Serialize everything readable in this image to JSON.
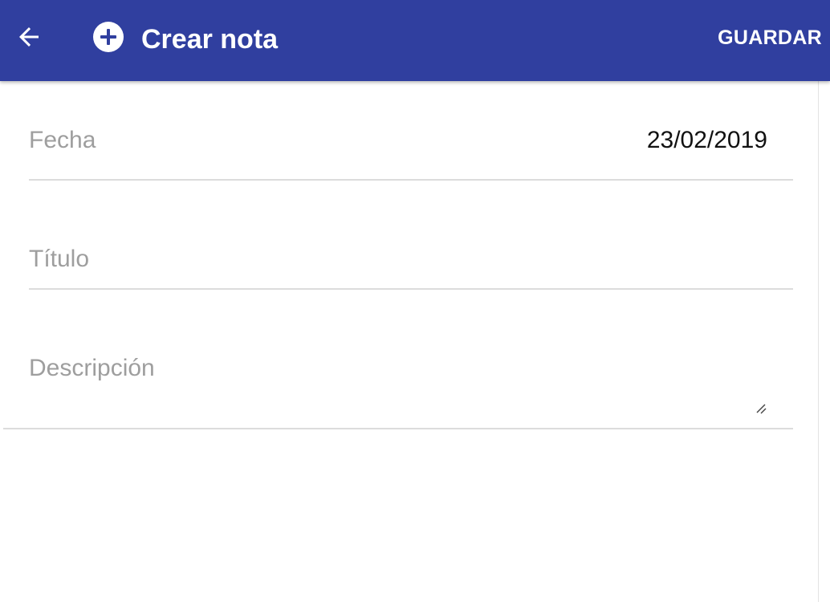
{
  "colors": {
    "header_background": "#303f9f",
    "header_text": "#ffffff",
    "label_text": "#9e9e9e",
    "value_text": "#111111",
    "divider": "#dcdcdc"
  },
  "header": {
    "back_icon": "arrow-back-icon",
    "title_icon": "add-circle-icon",
    "title": "Crear nota",
    "save_label": "GUARDAR"
  },
  "form": {
    "fecha": {
      "label": "Fecha",
      "value": "23/02/2019"
    },
    "titulo": {
      "label": "Título",
      "value": ""
    },
    "descripcion": {
      "label": "Descripción",
      "value": "",
      "resize_icon": "resize-handle-icon"
    }
  }
}
